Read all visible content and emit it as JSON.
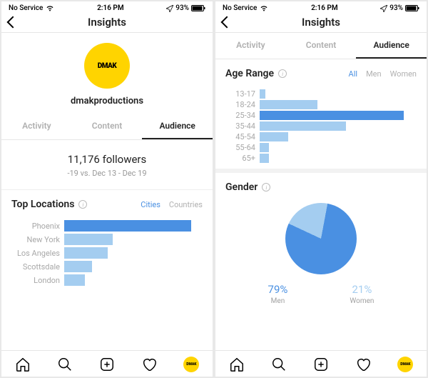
{
  "status": {
    "carrier": "No Service",
    "time": "2:16 PM",
    "battery_pct": "93%"
  },
  "nav": {
    "title": "Insights"
  },
  "profile": {
    "avatar_text": "DMAK",
    "username": "dmakproductions"
  },
  "tabs": {
    "activity": "Activity",
    "content": "Content",
    "audience": "Audience"
  },
  "followers": {
    "count": "11,176 followers",
    "delta": "-19 vs. Dec 13 - Dec 19"
  },
  "top_locations": {
    "title": "Top Locations",
    "filter_cities": "Cities",
    "filter_countries": "Countries"
  },
  "age_range": {
    "title": "Age Range",
    "filter_all": "All",
    "filter_men": "Men",
    "filter_women": "Women"
  },
  "gender": {
    "title": "Gender",
    "men_pct": "79%",
    "men_label": "Men",
    "women_pct": "21%",
    "women_label": "Women"
  },
  "chart_data": [
    {
      "type": "bar",
      "title": "Top Locations",
      "orientation": "horizontal",
      "categories": [
        "Phoenix",
        "New York",
        "Los Angeles",
        "Scottsdale",
        "London"
      ],
      "values": [
        100,
        38,
        34,
        22,
        16
      ],
      "highlight_index": 0,
      "unit": "relative_pct_of_max"
    },
    {
      "type": "bar",
      "title": "Age Range",
      "orientation": "horizontal",
      "categories": [
        "13-17",
        "18-24",
        "25-34",
        "35-44",
        "45-54",
        "55-64",
        "65+"
      ],
      "values": [
        3,
        30,
        75,
        45,
        15,
        5,
        5
      ],
      "highlight_index": 2,
      "unit": "relative_pct_of_max"
    },
    {
      "type": "pie",
      "title": "Gender",
      "series": [
        {
          "name": "Men",
          "value": 79,
          "color": "#4a90e2"
        },
        {
          "name": "Women",
          "value": 21,
          "color": "#a4cdf0"
        }
      ]
    }
  ]
}
